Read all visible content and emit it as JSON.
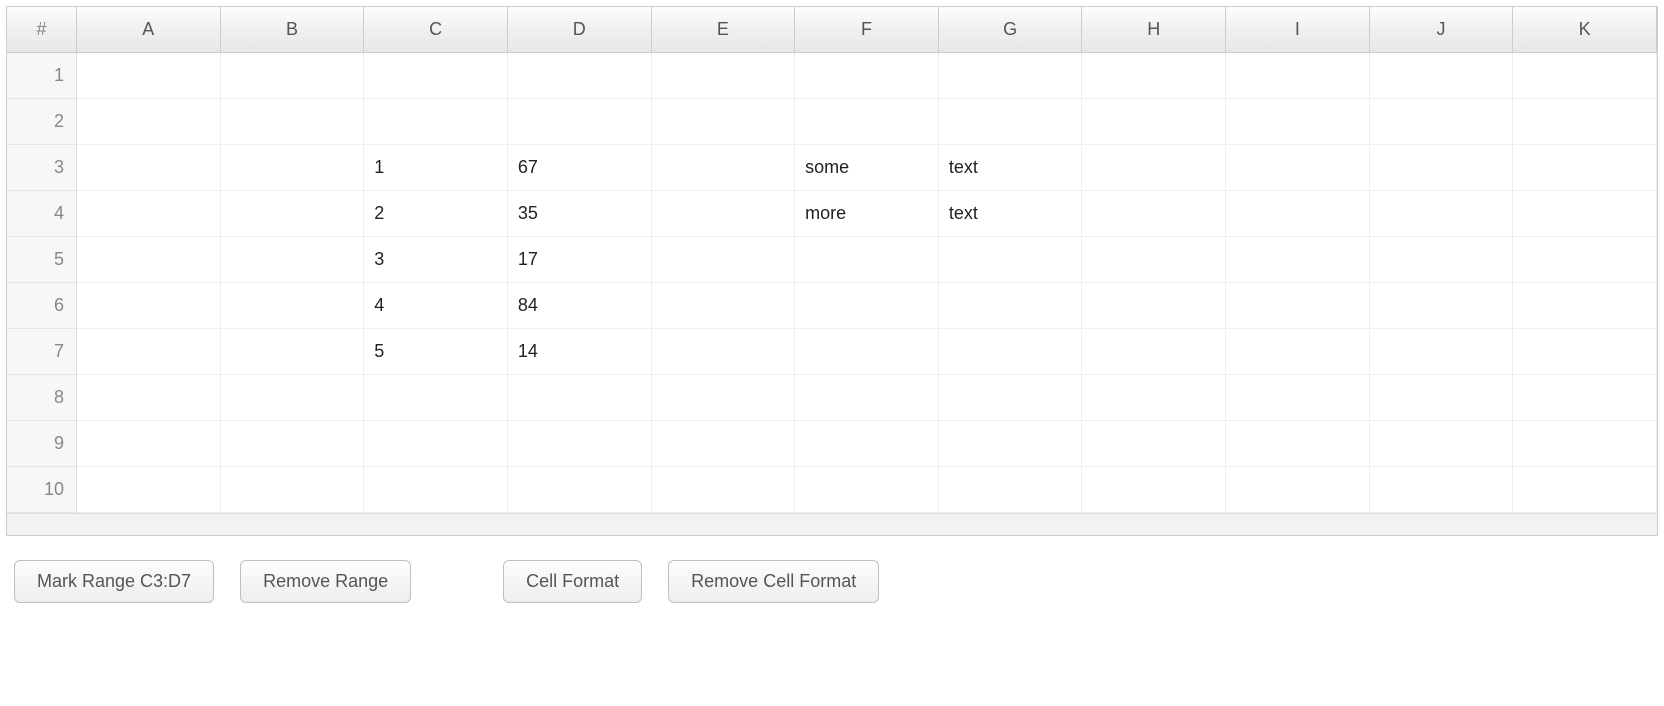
{
  "spreadsheet": {
    "corner": "#",
    "columns": [
      "A",
      "B",
      "C",
      "D",
      "E",
      "F",
      "G",
      "H",
      "I",
      "J",
      "K"
    ],
    "rows": [
      "1",
      "2",
      "3",
      "4",
      "5",
      "6",
      "7",
      "8",
      "9",
      "10"
    ],
    "cells": {
      "r3": {
        "C": "1",
        "D": "67",
        "F": "some",
        "G": "text"
      },
      "r4": {
        "C": "2",
        "D": "35",
        "F": "more",
        "G": "text"
      },
      "r5": {
        "C": "3",
        "D": "17"
      },
      "r6": {
        "C": "4",
        "D": "84"
      },
      "r7": {
        "C": "5",
        "D": "14"
      }
    }
  },
  "buttons": {
    "mark_range": "Mark Range C3:D7",
    "remove_range": "Remove Range",
    "cell_format": "Cell Format",
    "remove_cell_format": "Remove Cell Format"
  }
}
